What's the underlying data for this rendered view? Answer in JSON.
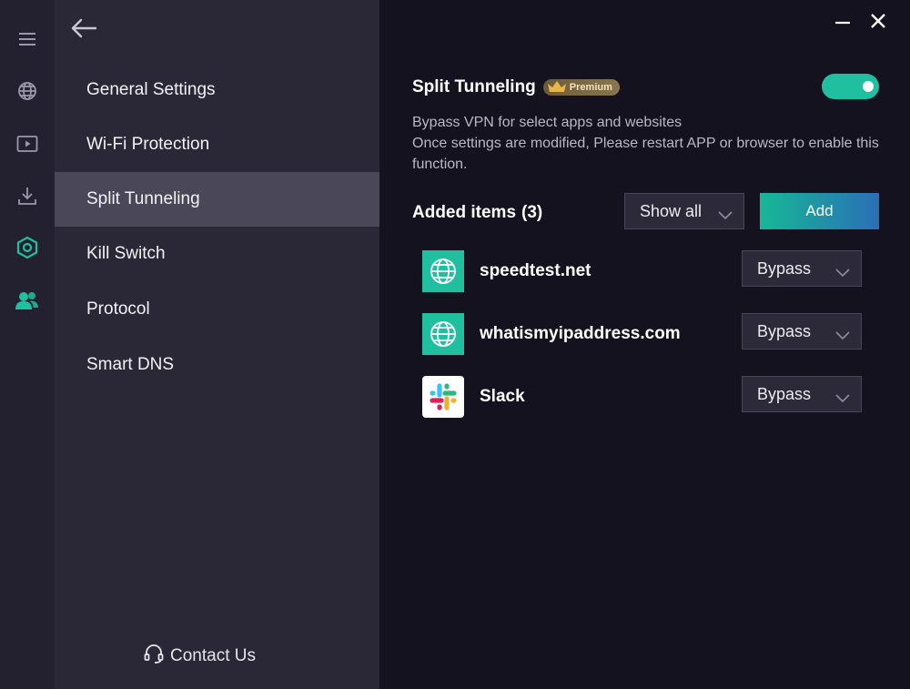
{
  "rail": {
    "items": [
      {
        "icon": "menu-icon"
      },
      {
        "icon": "globe-icon"
      },
      {
        "icon": "streaming-icon"
      },
      {
        "icon": "download-icon"
      },
      {
        "icon": "settings-hexagon-icon",
        "active": true
      },
      {
        "icon": "account-users-icon"
      }
    ]
  },
  "nav": {
    "items": [
      {
        "label": "General Settings"
      },
      {
        "label": "Wi-Fi Protection"
      },
      {
        "label": "Split Tunneling",
        "active": true
      },
      {
        "label": "Kill Switch"
      },
      {
        "label": "Protocol"
      },
      {
        "label": "Smart DNS"
      }
    ],
    "contact_label": "Contact Us"
  },
  "main": {
    "title": "Split Tunneling",
    "premium_badge": "Premium",
    "toggle_on": true,
    "description_line1": "Bypass VPN for select apps and websites",
    "description_line2": "Once settings are modified, Please restart APP or browser to enable this function.",
    "added_label": "Added items",
    "added_count": "(3)",
    "filter_value": "Show all",
    "add_label": "Add",
    "items": [
      {
        "name": "speedtest.net",
        "icon": "globe-icon",
        "mode": "Bypass"
      },
      {
        "name": "whatismyipaddress.com",
        "icon": "globe-icon",
        "mode": "Bypass"
      },
      {
        "name": "Slack",
        "icon": "slack-logo-icon",
        "mode": "Bypass"
      }
    ]
  },
  "colors": {
    "accent": "#1fbf9f",
    "accent_gradient_end": "#2a6fb6",
    "background": "#14121f",
    "nav_background": "#2a2837",
    "nav_active": "#4a4759",
    "rail_background": "#23212f"
  }
}
